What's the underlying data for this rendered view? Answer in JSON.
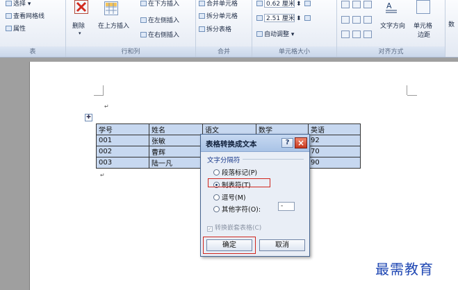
{
  "ribbon": {
    "table_group": {
      "items": [
        "选择 ▾",
        "查看网格线",
        "属性"
      ],
      "label": "表"
    },
    "rows_cols_group": {
      "delete_label": "删除",
      "insert_above_label": "在上方插入",
      "insert_below_label": "在下方插入",
      "insert_left_label": "在左侧插入",
      "insert_right_label": "在右侧插入",
      "label": "行和列"
    },
    "merge_group": {
      "merge_cells_label": "合并单元格",
      "split_cells_label": "拆分单元格",
      "split_table_label": "拆分表格",
      "label": "合并"
    },
    "cell_size_group": {
      "height_value": "0.62 厘米",
      "width_value": "2.51 厘米",
      "autofit_label": "自动调整 ▾",
      "label": "单元格大小"
    },
    "alignment_group": {
      "text_direction_label": "文字方向",
      "cell_margin_label_1": "单元格",
      "cell_margin_label_2": "边距",
      "label": "对齐方式"
    },
    "data_group_partial": "数"
  },
  "document": {
    "table": {
      "rows": [
        [
          "学号",
          "姓名",
          "语文",
          "数学",
          "英语"
        ],
        [
          "001",
          "张敏",
          "",
          "",
          "92"
        ],
        [
          "002",
          "曹辉",
          "",
          "",
          "70"
        ],
        [
          "003",
          "陆一凡",
          "",
          "",
          "90"
        ]
      ]
    }
  },
  "dialog": {
    "title": "表格转换成文本",
    "help_label": "?",
    "close_label": "×",
    "separator_legend": "文字分隔符",
    "options": [
      {
        "label": "段落标记(P)",
        "selected": false
      },
      {
        "label": "制表符(T)",
        "selected": true
      },
      {
        "label": "逗号(M)",
        "selected": false
      },
      {
        "label": "其他字符(O):",
        "selected": false
      }
    ],
    "other_char_value": "-",
    "nested_checkbox_label": "转换嵌套表格(C)",
    "ok_label": "确定",
    "cancel_label": "取消"
  },
  "watermark": "最需教育",
  "colors": {
    "highlight_red": "#d0251c",
    "table_selection": "#c7d8f0",
    "watermark_blue": "#1f47b3"
  }
}
